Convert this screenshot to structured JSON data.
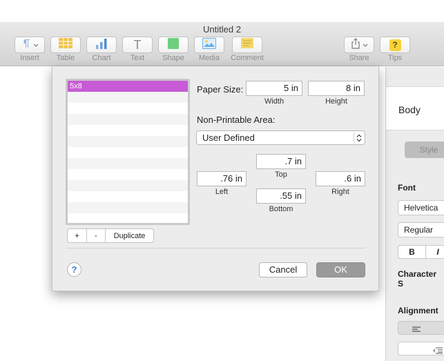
{
  "window": {
    "title": "Untitled 2"
  },
  "toolbar": {
    "items": [
      {
        "label": "Insert",
        "icon": "paragraph-icon"
      },
      {
        "label": "Table",
        "icon": "table-icon"
      },
      {
        "label": "Chart",
        "icon": "chart-icon"
      },
      {
        "label": "Text",
        "icon": "text-icon"
      },
      {
        "label": "Shape",
        "icon": "shape-icon"
      },
      {
        "label": "Media",
        "icon": "media-icon"
      },
      {
        "label": "Comment",
        "icon": "comment-icon"
      },
      {
        "label": "Share",
        "icon": "share-icon"
      },
      {
        "label": "Tips",
        "icon": "tips-icon"
      }
    ],
    "text_glyph": "T",
    "tips_glyph": "?"
  },
  "inspector": {
    "paragraph_style": "Body",
    "style_tab": "Style",
    "font_heading": "Font",
    "font_family": "Helvetica",
    "font_weight": "Regular",
    "bold_label": "B",
    "italic_label": "I",
    "character_styles_heading": "Character S",
    "alignment_heading": "Alignment"
  },
  "dialog": {
    "paper_list": {
      "items": [
        "5x8"
      ],
      "selected_index": 0
    },
    "list_buttons": {
      "add": "+",
      "remove": "-",
      "duplicate": "Duplicate"
    },
    "paper_size_label": "Paper Size:",
    "width": {
      "value": "5 in",
      "label": "Width"
    },
    "height": {
      "value": "8 in",
      "label": "Height"
    },
    "non_printable_label": "Non-Printable Area:",
    "non_printable_select": "User Defined",
    "top": {
      "value": ".7 in",
      "label": "Top"
    },
    "left": {
      "value": ".76 in",
      "label": "Left"
    },
    "right": {
      "value": ".6 in",
      "label": "Right"
    },
    "bottom": {
      "value": ".55 in",
      "label": "Bottom"
    },
    "help": "?",
    "cancel": "Cancel",
    "ok": "OK"
  },
  "colors": {
    "selection": "#c75bd6",
    "ok_button": "#9a9a9a",
    "help_accent": "#3a7de0",
    "tips_icon": "#f7d23a",
    "shape_icon": "#6fcf7e",
    "media_icon": "#6aaee8",
    "comment_icon": "#f5d66a"
  }
}
